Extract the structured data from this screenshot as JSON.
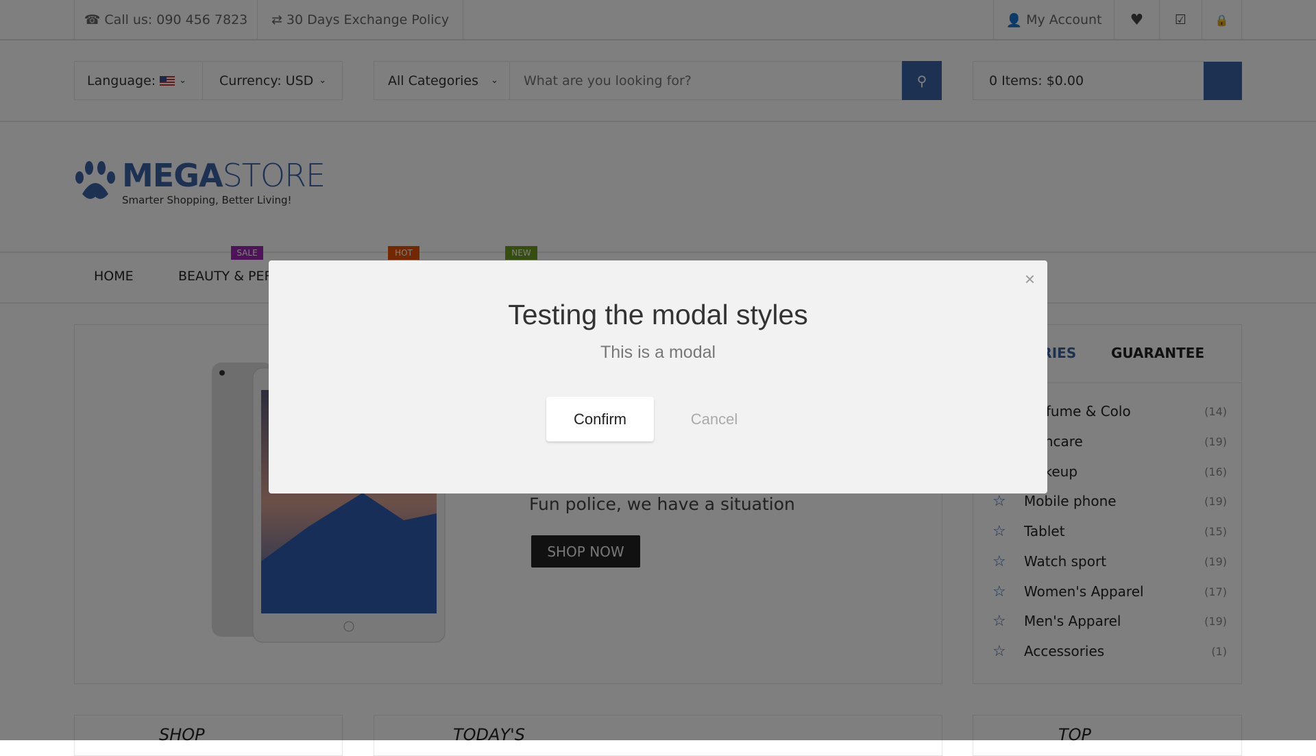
{
  "topbar": {
    "phone": "Call us: 090 456 7823",
    "exchange": "30 Days Exchange Policy",
    "account": "My Account"
  },
  "header": {
    "language_label": "Language:",
    "currency_label": "Currency: USD",
    "categories_select": "All Categories",
    "search_placeholder": "What are you looking for?",
    "cart_label": "0 Items: $0.00"
  },
  "logo": {
    "brand_bold": "MEGA",
    "brand_light": "STORE",
    "tagline": "Smarter Shopping, Better Living!"
  },
  "nav": {
    "items": [
      "HOME",
      "BEAUTY & PERFUME"
    ],
    "badges": [
      "SALE",
      "HOT",
      "NEW"
    ],
    "badge_colors": [
      "#9c27b0",
      "#e65100",
      "#6a9a1f"
    ]
  },
  "slider": {
    "caption": "Fun police, we have a situation",
    "cta": "SHOP NOW"
  },
  "sidebar": {
    "tabs": [
      "CATEGORIES",
      "GUARANTEE"
    ],
    "categories": [
      {
        "name": "Perfume & Colo",
        "count": "(14)"
      },
      {
        "name": "Skincare",
        "count": "(19)"
      },
      {
        "name": "Makeup",
        "count": "(16)"
      },
      {
        "name": "Mobile phone",
        "count": "(19)"
      },
      {
        "name": "Tablet",
        "count": "(15)"
      },
      {
        "name": "Watch sport",
        "count": "(19)"
      },
      {
        "name": "Women's Apparel",
        "count": "(17)"
      },
      {
        "name": "Men's Apparel",
        "count": "(19)"
      },
      {
        "name": "Accessories",
        "count": "(1)"
      }
    ]
  },
  "bottom": {
    "sections": [
      "SHOP",
      "TODAY'S",
      "TOP"
    ]
  },
  "modal": {
    "title": "Testing the modal styles",
    "subtitle": "This is a modal",
    "confirm": "Confirm",
    "cancel": "Cancel"
  },
  "colors": {
    "accent": "#3b64a6",
    "overlay": "rgba(0,0,0,0.5)"
  }
}
